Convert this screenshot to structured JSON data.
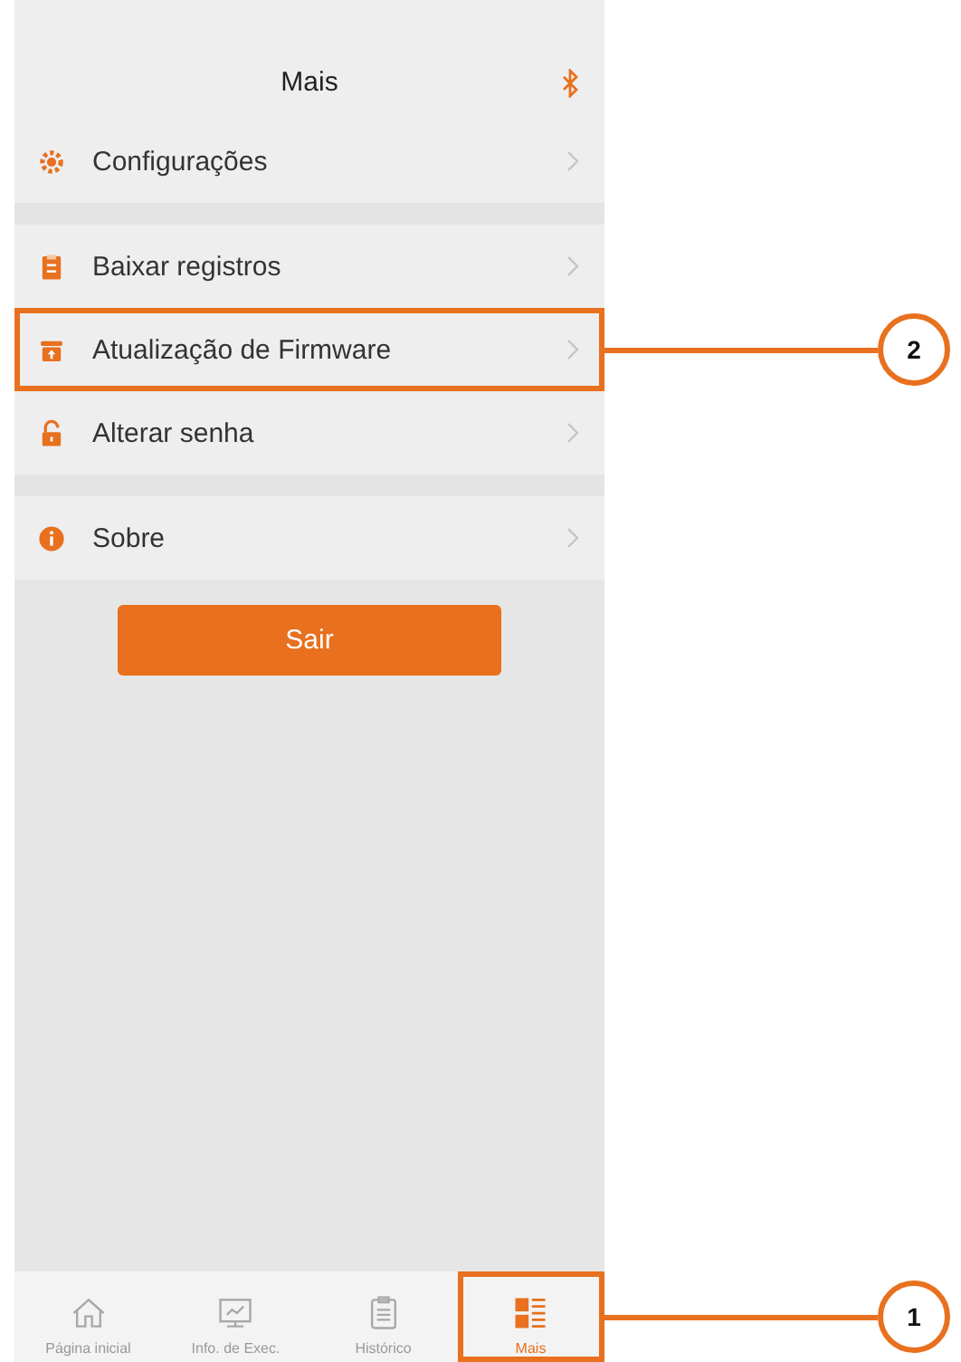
{
  "header": {
    "title": "Mais"
  },
  "menu_groups": [
    [
      {
        "label": "Configurações",
        "kind": "gear"
      }
    ],
    [
      {
        "label": "Baixar registros",
        "kind": "clipboard"
      },
      {
        "label": "Atualização de Firmware",
        "kind": "box",
        "callout": "2"
      },
      {
        "label": "Alterar senha",
        "kind": "lock"
      }
    ],
    [
      {
        "label": "Sobre",
        "kind": "info"
      }
    ]
  ],
  "logout_button": "Sair",
  "tabs": [
    {
      "label": "Página inicial",
      "kind": "home",
      "selected": false
    },
    {
      "label": "Info. de Exec.",
      "kind": "monitor",
      "selected": false
    },
    {
      "label": "Histórico",
      "kind": "clipboard",
      "selected": false
    },
    {
      "label": "Mais",
      "kind": "list",
      "selected": true,
      "callout": "1"
    }
  ]
}
